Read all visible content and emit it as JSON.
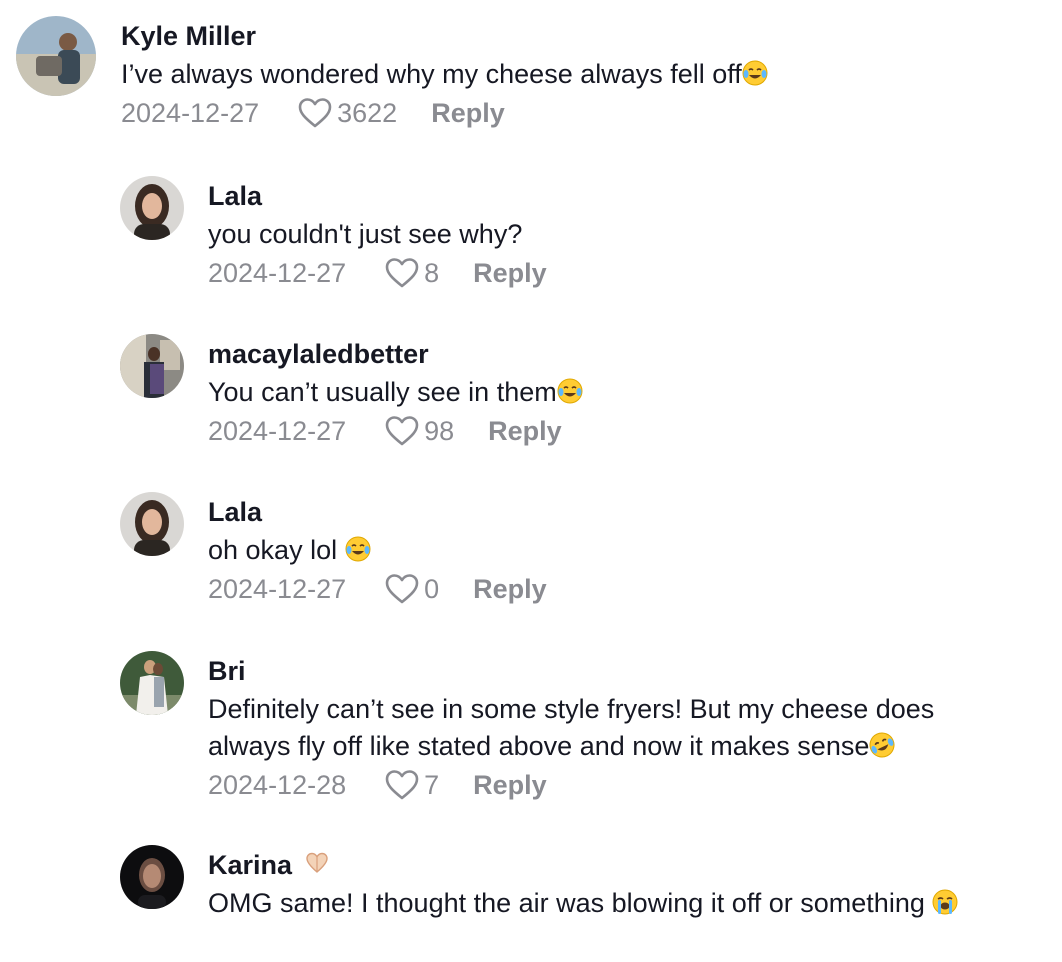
{
  "comments": [
    {
      "username": "Kyle Miller",
      "text": "I’ve always wondered why my cheese always fell off",
      "emoji": "😂",
      "date": "2024-12-27",
      "likes": "3622",
      "reply_label": "Reply"
    },
    {
      "username": "Lala",
      "text": "you couldn't just see why?",
      "date": "2024-12-27",
      "likes": "8",
      "reply_label": "Reply"
    },
    {
      "username": "macaylaledbetter",
      "text": "You can’t usually see in them",
      "emoji": "😂",
      "date": "2024-12-27",
      "likes": "98",
      "reply_label": "Reply"
    },
    {
      "username": "Lala",
      "text": "oh okay lol ",
      "emoji": "😂",
      "date": "2024-12-27",
      "likes": "0",
      "reply_label": "Reply"
    },
    {
      "username": "Bri",
      "text_line1": "Definitely can’t see in some style fryers! But my cheese does",
      "text_line2": "always fly off like stated above and now it makes sense",
      "emoji": "🤣",
      "date": "2024-12-28",
      "likes": "7",
      "reply_label": "Reply"
    },
    {
      "username": "Karina",
      "username_emoji": "🫶🏼",
      "text": "OMG same! I thought the air was blowing it off or something ",
      "emoji": "😭"
    }
  ],
  "colors": {
    "text_primary": "#161823",
    "text_secondary": "#8a8b91"
  },
  "icons": {
    "like": "heart-outline-icon",
    "laugh": "face-with-tears-of-joy-emoji",
    "rofl": "rolling-on-the-floor-laughing-emoji",
    "cry": "loudly-crying-face-emoji",
    "heart_hands": "heart-hands-emoji"
  }
}
